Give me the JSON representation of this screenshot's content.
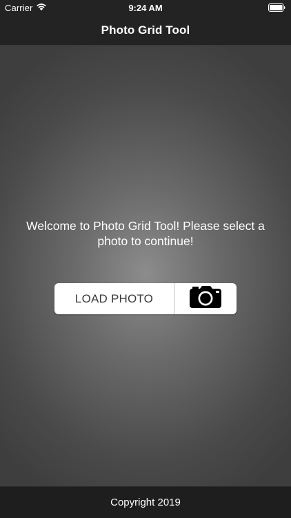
{
  "status_bar": {
    "carrier": "Carrier",
    "time": "9:24 AM",
    "icons": [
      "wifi-icon",
      "battery-icon"
    ]
  },
  "nav": {
    "title": "Photo Grid Tool"
  },
  "main": {
    "welcome_text": "Welcome to Photo Grid Tool! Please select a photo to continue!",
    "load_button_label": "LOAD PHOTO",
    "camera_button_icon": "camera-icon"
  },
  "footer": {
    "copyright": "Copyright 2019"
  },
  "colors": {
    "bar_background": "#232323",
    "footer_background": "#1e1e1e",
    "button_background": "#ffffff",
    "text_on_dark": "#ffffff",
    "button_text": "#3a3a3a"
  }
}
